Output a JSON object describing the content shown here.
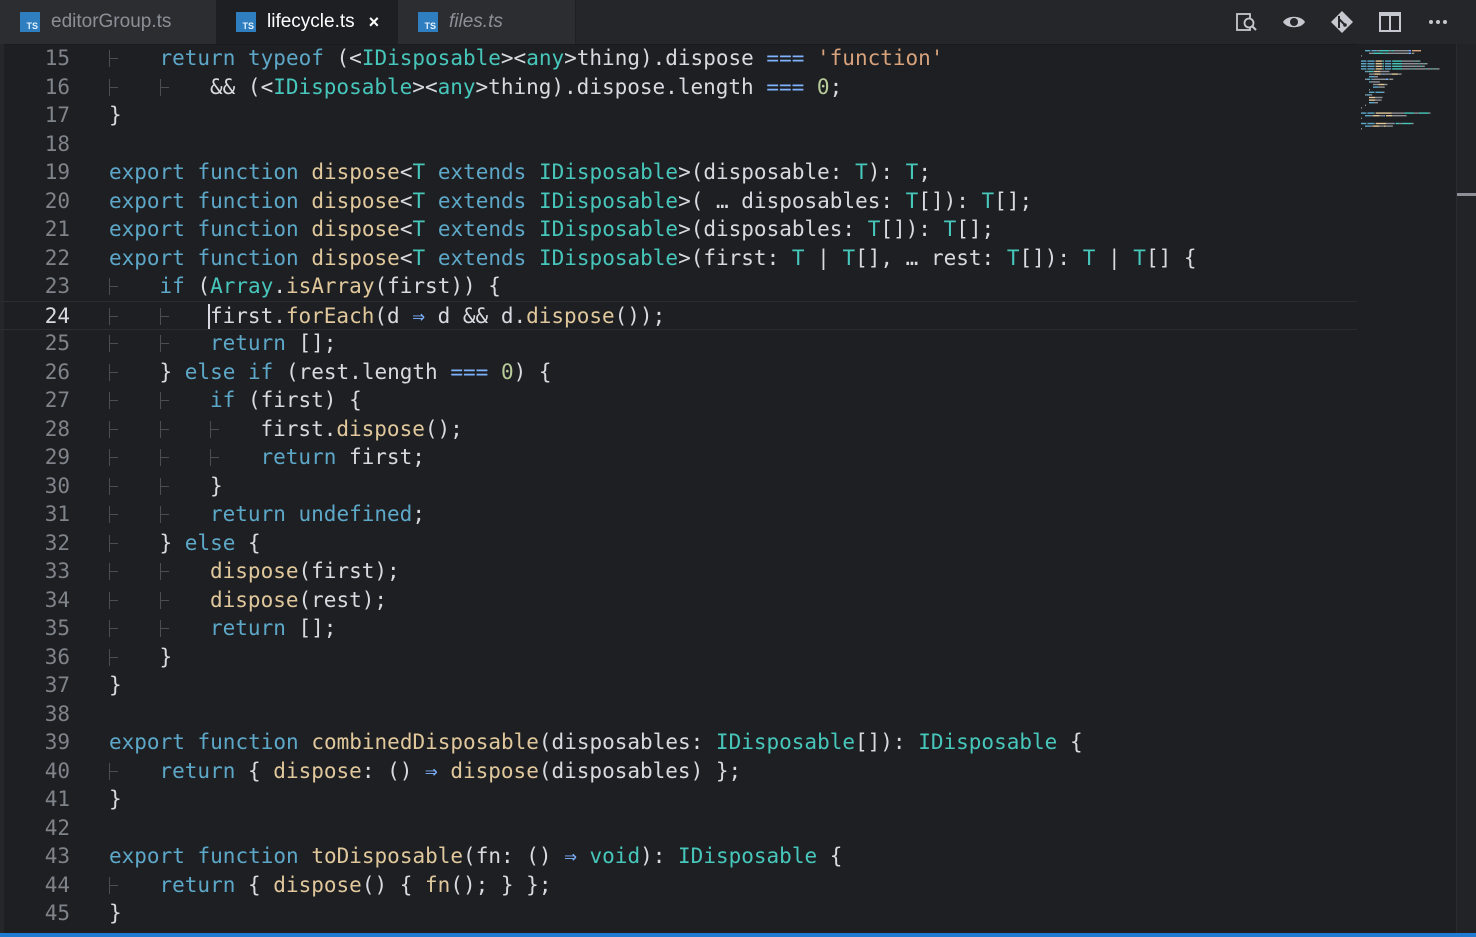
{
  "tabs": [
    {
      "label": "editorGroup.ts",
      "icon": "TS",
      "active": false
    },
    {
      "label": "lifecycle.ts",
      "icon": "TS",
      "active": true
    },
    {
      "label": "files.ts",
      "icon": "TS",
      "active": false
    }
  ],
  "close_glyph": "×",
  "actions": [
    "open-changes-icon",
    "toggle-diff-icon",
    "git-compare-icon",
    "split-editor-icon",
    "more-actions-icon"
  ],
  "editor": {
    "current_line": "24",
    "lines": [
      {
        "n": "15",
        "tokens": [
          [
            "k",
            "return"
          ],
          [
            "v",
            " "
          ],
          [
            "k",
            "typeof"
          ],
          [
            "v",
            " (<"
          ],
          [
            "t",
            "IDisposable"
          ],
          [
            "v",
            "><"
          ],
          [
            "t",
            "any"
          ],
          [
            "v",
            ">thing).dispose "
          ],
          [
            "o",
            "==="
          ],
          [
            "v",
            " "
          ],
          [
            "s",
            "'function'"
          ]
        ]
      },
      {
        "n": "16",
        "tokens": [
          [
            "v",
            "&& (<"
          ],
          [
            "t",
            "IDisposable"
          ],
          [
            "v",
            "><"
          ],
          [
            "t",
            "any"
          ],
          [
            "v",
            ">thing).dispose.length "
          ],
          [
            "o",
            "==="
          ],
          [
            "v",
            " "
          ],
          [
            "n",
            "0"
          ],
          [
            "v",
            ";"
          ]
        ]
      },
      {
        "n": "17",
        "tokens": [
          [
            "v",
            "}"
          ]
        ]
      },
      {
        "n": "18",
        "tokens": []
      },
      {
        "n": "19",
        "tokens": [
          [
            "k",
            "export"
          ],
          [
            "v",
            " "
          ],
          [
            "k",
            "function"
          ],
          [
            "v",
            " "
          ],
          [
            "f",
            "dispose"
          ],
          [
            "v",
            "<"
          ],
          [
            "t",
            "T"
          ],
          [
            "v",
            " "
          ],
          [
            "k",
            "extends"
          ],
          [
            "v",
            " "
          ],
          [
            "t",
            "IDisposable"
          ],
          [
            "v",
            ">(disposable: "
          ],
          [
            "t",
            "T"
          ],
          [
            "v",
            "): "
          ],
          [
            "t",
            "T"
          ],
          [
            "v",
            ";"
          ]
        ]
      },
      {
        "n": "20",
        "tokens": [
          [
            "k",
            "export"
          ],
          [
            "v",
            " "
          ],
          [
            "k",
            "function"
          ],
          [
            "v",
            " "
          ],
          [
            "f",
            "dispose"
          ],
          [
            "v",
            "<"
          ],
          [
            "t",
            "T"
          ],
          [
            "v",
            " "
          ],
          [
            "k",
            "extends"
          ],
          [
            "v",
            " "
          ],
          [
            "t",
            "IDisposable"
          ],
          [
            "v",
            ">( … disposables: "
          ],
          [
            "t",
            "T"
          ],
          [
            "v",
            "[]): "
          ],
          [
            "t",
            "T"
          ],
          [
            "v",
            "[];"
          ]
        ]
      },
      {
        "n": "21",
        "tokens": [
          [
            "k",
            "export"
          ],
          [
            "v",
            " "
          ],
          [
            "k",
            "function"
          ],
          [
            "v",
            " "
          ],
          [
            "f",
            "dispose"
          ],
          [
            "v",
            "<"
          ],
          [
            "t",
            "T"
          ],
          [
            "v",
            " "
          ],
          [
            "k",
            "extends"
          ],
          [
            "v",
            " "
          ],
          [
            "t",
            "IDisposable"
          ],
          [
            "v",
            ">(disposables: "
          ],
          [
            "t",
            "T"
          ],
          [
            "v",
            "[]): "
          ],
          [
            "t",
            "T"
          ],
          [
            "v",
            "[];"
          ]
        ]
      },
      {
        "n": "22",
        "tokens": [
          [
            "k",
            "export"
          ],
          [
            "v",
            " "
          ],
          [
            "k",
            "function"
          ],
          [
            "v",
            " "
          ],
          [
            "f",
            "dispose"
          ],
          [
            "v",
            "<"
          ],
          [
            "t",
            "T"
          ],
          [
            "v",
            " "
          ],
          [
            "k",
            "extends"
          ],
          [
            "v",
            " "
          ],
          [
            "t",
            "IDisposable"
          ],
          [
            "v",
            ">(first: "
          ],
          [
            "t",
            "T"
          ],
          [
            "v",
            " | "
          ],
          [
            "t",
            "T"
          ],
          [
            "v",
            "[], … rest: "
          ],
          [
            "t",
            "T"
          ],
          [
            "v",
            "[]): "
          ],
          [
            "t",
            "T"
          ],
          [
            "v",
            " | "
          ],
          [
            "t",
            "T"
          ],
          [
            "v",
            "[] {"
          ]
        ]
      },
      {
        "n": "23",
        "tokens": [
          [
            "k",
            "if"
          ],
          [
            "v",
            " ("
          ],
          [
            "t",
            "Array"
          ],
          [
            "v",
            "."
          ],
          [
            "f",
            "isArray"
          ],
          [
            "v",
            "(first)) {"
          ]
        ]
      },
      {
        "n": "24",
        "tokens": [
          [
            "v",
            "first."
          ],
          [
            "f",
            "forEach"
          ],
          [
            "v",
            "(d "
          ],
          [
            "o",
            "⇒"
          ],
          [
            "v",
            " d && d."
          ],
          [
            "f",
            "dispose"
          ],
          [
            "v",
            "());"
          ]
        ]
      },
      {
        "n": "25",
        "tokens": [
          [
            "k",
            "return"
          ],
          [
            "v",
            " [];"
          ]
        ]
      },
      {
        "n": "26",
        "tokens": [
          [
            "v",
            "} "
          ],
          [
            "k",
            "else"
          ],
          [
            "v",
            " "
          ],
          [
            "k",
            "if"
          ],
          [
            "v",
            " (rest.length "
          ],
          [
            "o",
            "==="
          ],
          [
            "v",
            " "
          ],
          [
            "n",
            "0"
          ],
          [
            "v",
            ") {"
          ]
        ]
      },
      {
        "n": "27",
        "tokens": [
          [
            "k",
            "if"
          ],
          [
            "v",
            " (first) {"
          ]
        ]
      },
      {
        "n": "28",
        "tokens": [
          [
            "v",
            "first."
          ],
          [
            "f",
            "dispose"
          ],
          [
            "v",
            "();"
          ]
        ]
      },
      {
        "n": "29",
        "tokens": [
          [
            "k",
            "return"
          ],
          [
            "v",
            " first;"
          ]
        ]
      },
      {
        "n": "30",
        "tokens": [
          [
            "v",
            "}"
          ]
        ]
      },
      {
        "n": "31",
        "tokens": [
          [
            "k",
            "return"
          ],
          [
            "v",
            " "
          ],
          [
            "k",
            "undefined"
          ],
          [
            "v",
            ";"
          ]
        ]
      },
      {
        "n": "32",
        "tokens": [
          [
            "v",
            "} "
          ],
          [
            "k",
            "else"
          ],
          [
            "v",
            " {"
          ]
        ]
      },
      {
        "n": "33",
        "tokens": [
          [
            "f",
            "dispose"
          ],
          [
            "v",
            "(first);"
          ]
        ]
      },
      {
        "n": "34",
        "tokens": [
          [
            "f",
            "dispose"
          ],
          [
            "v",
            "(rest);"
          ]
        ]
      },
      {
        "n": "35",
        "tokens": [
          [
            "k",
            "return"
          ],
          [
            "v",
            " [];"
          ]
        ]
      },
      {
        "n": "36",
        "tokens": [
          [
            "v",
            "}"
          ]
        ]
      },
      {
        "n": "37",
        "tokens": [
          [
            "v",
            "}"
          ]
        ]
      },
      {
        "n": "38",
        "tokens": []
      },
      {
        "n": "39",
        "tokens": [
          [
            "k",
            "export"
          ],
          [
            "v",
            " "
          ],
          [
            "k",
            "function"
          ],
          [
            "v",
            " "
          ],
          [
            "f",
            "combinedDisposable"
          ],
          [
            "v",
            "(disposables: "
          ],
          [
            "t",
            "IDisposable"
          ],
          [
            "v",
            "[]): "
          ],
          [
            "t",
            "IDisposable"
          ],
          [
            "v",
            " {"
          ]
        ]
      },
      {
        "n": "40",
        "tokens": [
          [
            "k",
            "return"
          ],
          [
            "v",
            " { "
          ],
          [
            "f",
            "dispose"
          ],
          [
            "v",
            ": () "
          ],
          [
            "o",
            "⇒"
          ],
          [
            "v",
            " "
          ],
          [
            "f",
            "dispose"
          ],
          [
            "v",
            "(disposables) };"
          ]
        ]
      },
      {
        "n": "41",
        "tokens": [
          [
            "v",
            "}"
          ]
        ]
      },
      {
        "n": "42",
        "tokens": []
      },
      {
        "n": "43",
        "tokens": [
          [
            "k",
            "export"
          ],
          [
            "v",
            " "
          ],
          [
            "k",
            "function"
          ],
          [
            "v",
            " "
          ],
          [
            "f",
            "toDisposable"
          ],
          [
            "v",
            "(fn: () "
          ],
          [
            "o",
            "⇒"
          ],
          [
            "v",
            " "
          ],
          [
            "t",
            "void"
          ],
          [
            "v",
            "): "
          ],
          [
            "t",
            "IDisposable"
          ],
          [
            "v",
            " {"
          ]
        ]
      },
      {
        "n": "44",
        "tokens": [
          [
            "k",
            "return"
          ],
          [
            "v",
            " { "
          ],
          [
            "f",
            "dispose"
          ],
          [
            "v",
            "() { "
          ],
          [
            "f",
            "fn"
          ],
          [
            "v",
            "(); } };"
          ]
        ]
      },
      {
        "n": "45",
        "tokens": [
          [
            "v",
            "}"
          ]
        ]
      }
    ]
  }
}
